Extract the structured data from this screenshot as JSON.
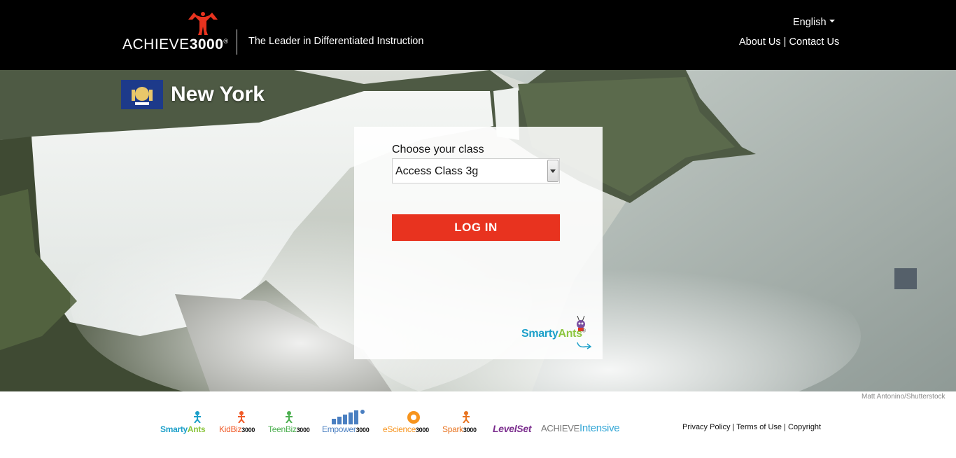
{
  "header": {
    "logo_thin": "ACHIEVE",
    "logo_bold": "3000",
    "logo_reg": "®",
    "tagline": "The Leader in Differentiated Instruction",
    "language": "English",
    "about": "About Us",
    "sep": " | ",
    "contact": "Contact Us"
  },
  "hero": {
    "state_name": "New York",
    "photo_credit": "Matt Antonino/Shutterstock"
  },
  "login": {
    "choose_label": "Choose your class",
    "selected_class": "Access Class 3g",
    "button": "LOG IN",
    "brand_smarty": "Smarty",
    "brand_ants": "Ants",
    "brand_reg": "®"
  },
  "footer": {
    "logos": [
      {
        "a": "Smarty",
        "b": "Ants",
        "c": ""
      },
      {
        "a": "KidBiz",
        "b": "",
        "c": "3000"
      },
      {
        "a": "TeenBiz",
        "b": "",
        "c": "3000"
      },
      {
        "a": "Empower",
        "b": "",
        "c": "3000"
      },
      {
        "a": "eScience",
        "b": "",
        "c": "3000"
      },
      {
        "a": "Spark",
        "b": "",
        "c": "3000"
      },
      {
        "a": "LevelSet",
        "b": "",
        "c": ""
      },
      {
        "a": "ACHIEVE",
        "b": "Intensive",
        "c": ""
      }
    ],
    "privacy": "Privacy Policy",
    "terms": "Terms of Use",
    "copyright": "Copyright",
    "sep": " | "
  },
  "colors": {
    "accent_red": "#e8331f",
    "topbar": "#000000",
    "smarty_teal": "#1b9fc9",
    "smarty_green": "#8cc63f"
  }
}
